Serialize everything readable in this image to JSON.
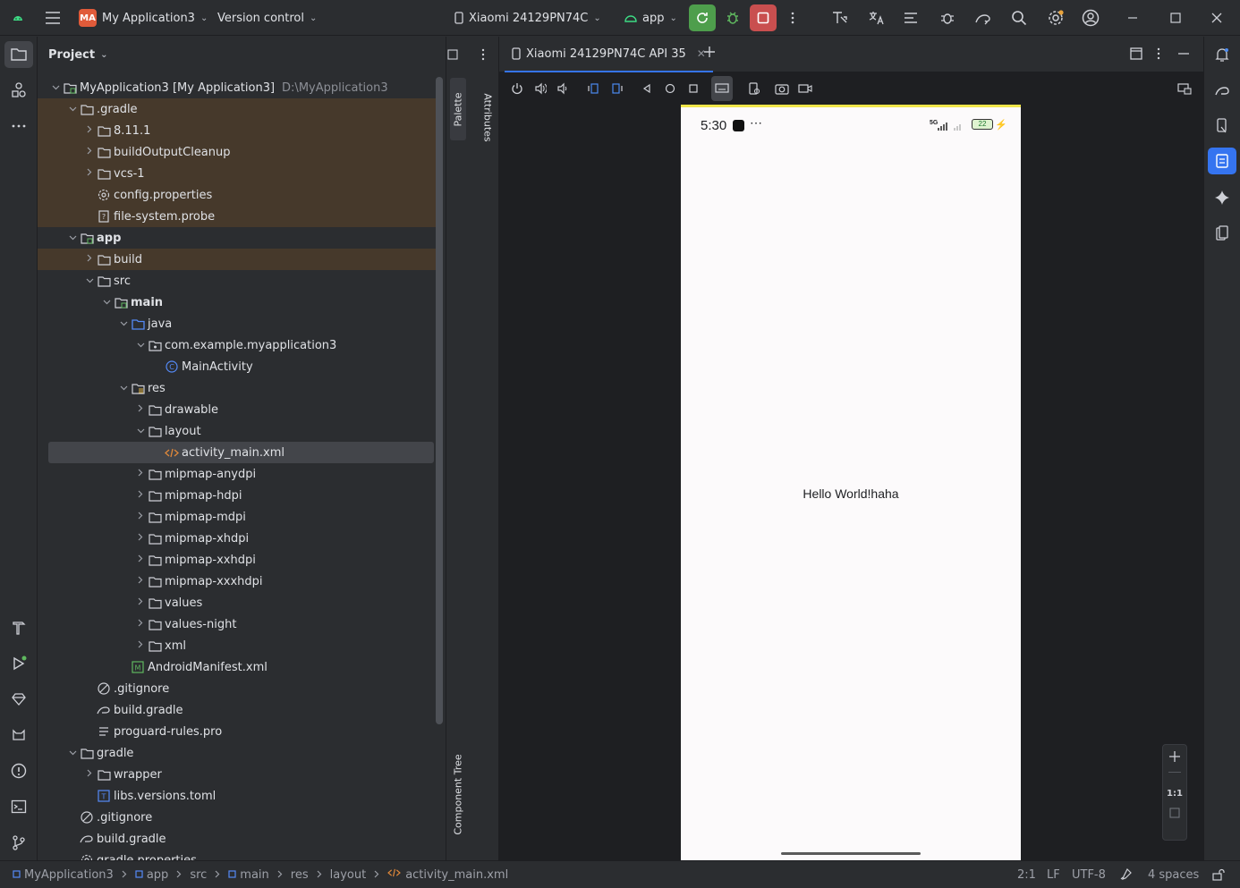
{
  "titlebar": {
    "project_badge": "MA",
    "project_name": "My Application3",
    "version_control": "Version control",
    "device": "Xiaomi 24129PN74C",
    "run_config": "app"
  },
  "project_panel": {
    "title": "Project",
    "tree": [
      {
        "label": "MyApplication3 [My Application3]",
        "extra": "D:\\MyApplication3",
        "icon": "module-folder-icon",
        "arrow": "down"
      },
      {
        "label": ".gradle",
        "icon": "folder-icon",
        "arrow": "down"
      },
      {
        "label": "8.11.1",
        "icon": "folder-icon",
        "arrow": "right"
      },
      {
        "label": "buildOutputCleanup",
        "icon": "folder-icon",
        "arrow": "right"
      },
      {
        "label": "vcs-1",
        "icon": "folder-icon",
        "arrow": "right"
      },
      {
        "label": "config.properties",
        "icon": "gear-file-icon",
        "arrow": ""
      },
      {
        "label": "file-system.probe",
        "icon": "unknown-file-icon",
        "arrow": ""
      },
      {
        "label": "app",
        "icon": "module-folder-icon",
        "arrow": "down"
      },
      {
        "label": "build",
        "icon": "folder-icon",
        "arrow": "right"
      },
      {
        "label": "src",
        "icon": "folder-icon",
        "arrow": "down"
      },
      {
        "label": "main",
        "icon": "module-folder-icon",
        "arrow": "down"
      },
      {
        "label": "java",
        "icon": "source-folder-icon",
        "arrow": "down"
      },
      {
        "label": "com.example.myapplication3",
        "icon": "package-icon",
        "arrow": "down"
      },
      {
        "label": "MainActivity",
        "icon": "class-icon",
        "arrow": ""
      },
      {
        "label": "res",
        "icon": "res-folder-icon",
        "arrow": "down"
      },
      {
        "label": "drawable",
        "icon": "folder-icon",
        "arrow": "right"
      },
      {
        "label": "layout",
        "icon": "folder-icon",
        "arrow": "down"
      },
      {
        "label": "activity_main.xml",
        "icon": "xml-file-icon",
        "arrow": ""
      },
      {
        "label": "mipmap-anydpi",
        "icon": "folder-icon",
        "arrow": "right"
      },
      {
        "label": "mipmap-hdpi",
        "icon": "folder-icon",
        "arrow": "right"
      },
      {
        "label": "mipmap-mdpi",
        "icon": "folder-icon",
        "arrow": "right"
      },
      {
        "label": "mipmap-xhdpi",
        "icon": "folder-icon",
        "arrow": "right"
      },
      {
        "label": "mipmap-xxhdpi",
        "icon": "folder-icon",
        "arrow": "right"
      },
      {
        "label": "mipmap-xxxhdpi",
        "icon": "folder-icon",
        "arrow": "right"
      },
      {
        "label": "values",
        "icon": "folder-icon",
        "arrow": "right"
      },
      {
        "label": "values-night",
        "icon": "folder-icon",
        "arrow": "right"
      },
      {
        "label": "xml",
        "icon": "folder-icon",
        "arrow": "right"
      },
      {
        "label": "AndroidManifest.xml",
        "icon": "manifest-file-icon",
        "arrow": ""
      },
      {
        "label": ".gitignore",
        "icon": "ignore-file-icon",
        "arrow": ""
      },
      {
        "label": "build.gradle",
        "icon": "gradle-file-icon",
        "arrow": ""
      },
      {
        "label": "proguard-rules.pro",
        "icon": "text-file-icon",
        "arrow": ""
      },
      {
        "label": "gradle",
        "icon": "folder-icon",
        "arrow": "down"
      },
      {
        "label": "wrapper",
        "icon": "folder-icon",
        "arrow": "right"
      },
      {
        "label": "libs.versions.toml",
        "icon": "toml-file-icon",
        "arrow": ""
      },
      {
        "label": ".gitignore",
        "icon": "ignore-file-icon",
        "arrow": ""
      },
      {
        "label": "build.gradle",
        "icon": "gradle-file-icon",
        "arrow": ""
      },
      {
        "label": "gradle.properties",
        "icon": "gear-file-icon",
        "arrow": ""
      }
    ]
  },
  "side_tabs": {
    "palette": "Palette",
    "attributes": "Attributes",
    "component_tree": "Component Tree"
  },
  "editor": {
    "tab_label": "Xiaomi 24129PN74C API 35"
  },
  "device": {
    "time": "5:30",
    "battery": "22",
    "network": "5G",
    "hello_text": "Hello World!haha"
  },
  "zoom": {
    "ratio": "1:1"
  },
  "statusbar": {
    "breadcrumb": [
      "MyApplication3",
      "app",
      "src",
      "main",
      "res",
      "layout",
      "activity_main.xml"
    ],
    "position": "2:1",
    "line_sep": "LF",
    "encoding": "UTF-8",
    "indent": "4 spaces"
  },
  "colors": {
    "accent": "#3574f0",
    "run_green": "#4e9e4c",
    "stop_red": "#c94f4f",
    "excluded_highlight": "#46392b",
    "device_top_bar": "#f0e64a"
  }
}
